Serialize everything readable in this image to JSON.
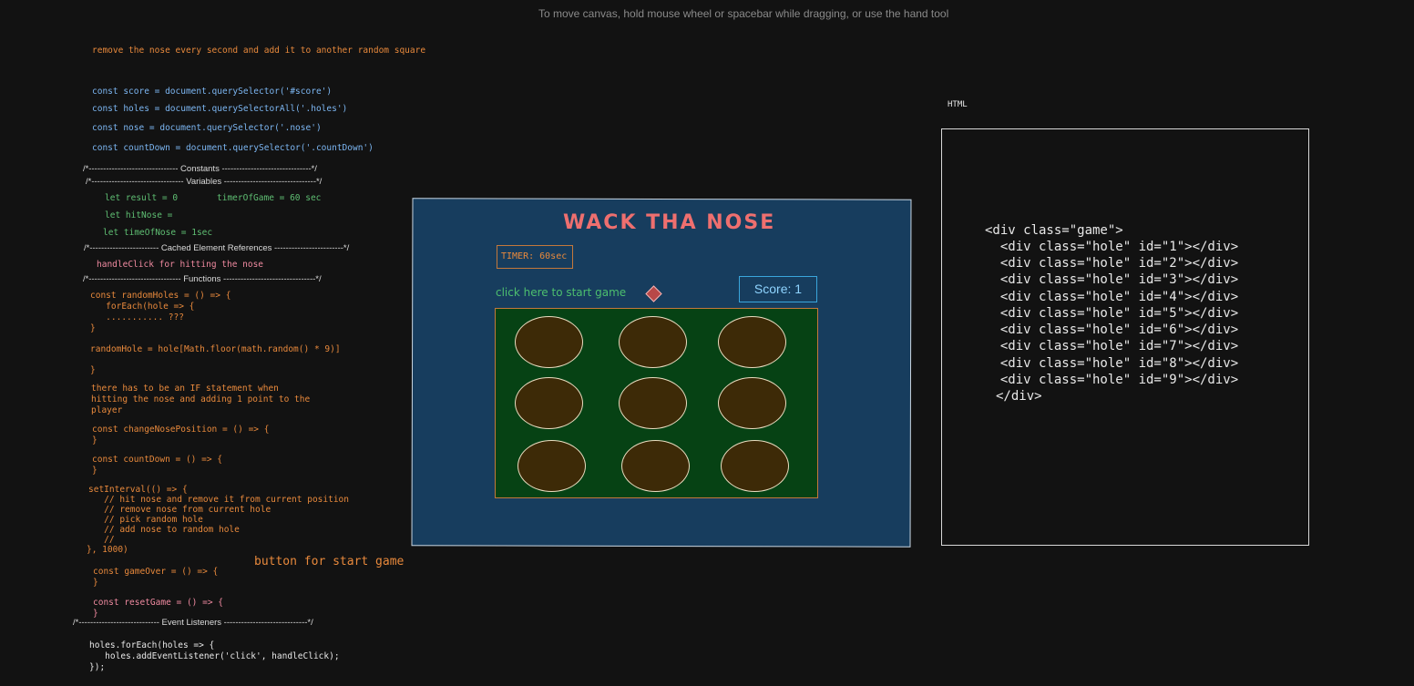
{
  "canvas_hint": "To move canvas, hold mouse wheel or spacebar while dragging, or use the hand tool",
  "notes": {
    "remove_nose": "remove the nose every second and add it to another random square",
    "const_score": "const score = document.querySelector('#score')",
    "const_holes": "const holes = document.querySelectorAll('.holes')",
    "const_nose": "const nose = document.querySelector('.nose')",
    "const_countdown": "const countDown = document.querySelector('.countDown')",
    "sep_constants": "/*------------------------------- Constants -------------------------------*/",
    "sep_variables": "/*-------------------------------- Variables --------------------------------*/",
    "let_result": "let result = 0",
    "timer_of_game": "timerOfGame = 60 sec",
    "let_hitnose": "let hitNose =",
    "let_timeofnose": "let timeOfNose = 1sec",
    "sep_cached": "/*------------------------ Cached Element References ------------------------*/",
    "handle_click": "handleClick for hitting the nose",
    "sep_functions": "/*-------------------------------- Functions --------------------------------*/",
    "random_holes_1": "const randomHoles = () => {",
    "random_holes_2": "   forEach(hole => {",
    "random_holes_3": "   ........... ???",
    "random_holes_4": "}",
    "random_hole": "randomHole = hole[Math.floor(math.random() * 9)]",
    "close_brace_1": "}",
    "if_stmt_1": "there has to be an IF statement when",
    "if_stmt_2": "hitting the nose and adding 1 point to the",
    "if_stmt_3": "player",
    "change_nose_1": "const changeNosePosition = () => {",
    "change_nose_2": "}",
    "countdown_1": "const countDown = () => {",
    "countdown_2": "}",
    "interval_1": "setInterval(() => {",
    "interval_2": "   // hit nose and remove it from current position",
    "interval_3": "   // remove nose from current hole",
    "interval_4": "   // pick random hole",
    "interval_5": "   // add nose to random hole",
    "interval_6": "   //",
    "interval_7": "}, 1000)",
    "start_button_note": "button for start game",
    "game_over_1": "const gameOver = () => {",
    "game_over_2": "}",
    "reset_game_1": "const resetGame = () => {",
    "reset_game_2": "}",
    "sep_events": "/*---------------------------- Event Listeners -----------------------------*/",
    "listener_1": "holes.forEach(holes => {",
    "listener_2": "   holes.addEventListener('click', handleClick);",
    "listener_3": "});"
  },
  "game": {
    "title": "WACK THA NOSE",
    "timer": "TIMER: 60sec",
    "start_text": "click here to start game",
    "score": "Score: 1",
    "hole_count": 9,
    "colors": {
      "frame": "#173d5e",
      "board": "#064214",
      "hole": "#3d2a07",
      "title": "#ee6f6f"
    }
  },
  "html_panel": {
    "label": "HTML",
    "lines": [
      "<div class=\"game\">",
      "  <div class=\"hole\" id=\"1\"></div>",
      "  <div class=\"hole\" id=\"2\"></div>",
      "  <div class=\"hole\" id=\"3\"></div>",
      "  <div class=\"hole\" id=\"4\"></div>",
      "  <div class=\"hole\" id=\"5\"></div>",
      "  <div class=\"hole\" id=\"6\"></div>",
      "  <div class=\"hole\" id=\"7\"></div>",
      "  <div class=\"hole\" id=\"8\"></div>",
      "  <div class=\"hole\" id=\"9\"></div>",
      "</div>"
    ]
  }
}
